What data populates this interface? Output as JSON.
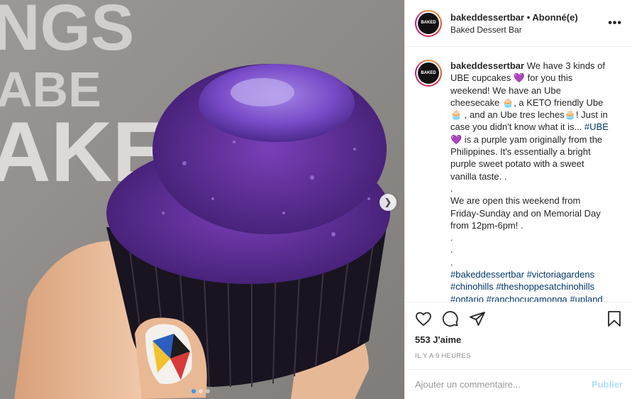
{
  "photo": {
    "wall_text": [
      "NGS",
      "ABE",
      "AKED"
    ],
    "next_icon": "chevron-right-icon",
    "dots": [
      true,
      false,
      false
    ]
  },
  "header": {
    "username": "bakeddessertbar",
    "separator": "•",
    "follow_status": "Abonné(e)",
    "subtitle": "Baked Dessert Bar",
    "avatar_text": "BAKED",
    "more_icon": "more-options-icon"
  },
  "caption": {
    "username": "bakeddessertbar",
    "line1": "We have 3 kinds of UBE cupcakes ",
    "heart": "💜",
    "line2": " for you this weekend! We have an Ube cheesecake ",
    "cup1": "🧁",
    "line3": ", a KETO friendly Ube ",
    "cup2": "🧁",
    "line4": " , and an Ube tres leches",
    "cup3": "🧁",
    "line5": "! Just in case you didn't know what it is... ",
    "tag_ube": "#UBE",
    "heart2": "💜",
    "line6": " is a purple yam originally from the Philippines. It's essentially a bright purple sweet potato with a sweet vanilla taste. .",
    "dot1": ".",
    "para2": "We are open this weekend from Friday-Sunday and on Memorial Day from 12pm-6pm! .",
    "dot2": ".",
    "dot3": ".",
    "dot4": ".",
    "hashtags1": "#bakeddessertbar #victoriagardens",
    "hashtags2": "#chinohills #theshoppesatchinohills",
    "hashtags3": "#ontario #ranchocucamonga #upland"
  },
  "actions": {
    "likes": "553 J'aime",
    "time": "IL Y A 9 HEURES"
  },
  "comment": {
    "placeholder": "Ajouter un commentaire...",
    "publish": "Publier"
  },
  "colors": {
    "accent_link": "#00376b",
    "publish_disabled": "#b2dffc",
    "dot_active": "#3897f0"
  }
}
